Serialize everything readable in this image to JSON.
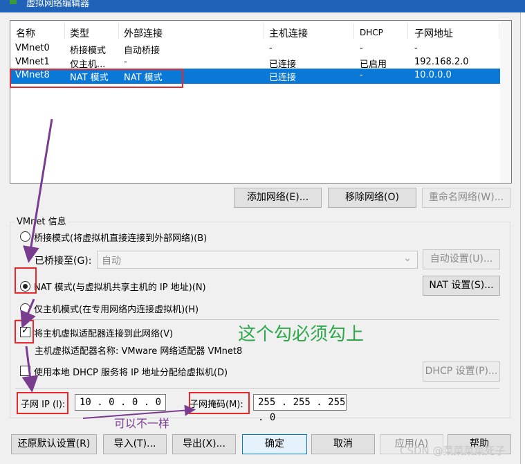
{
  "window": {
    "title": "虚拟网络编辑器"
  },
  "table": {
    "headers": [
      "名称",
      "类型",
      "外部连接",
      "主机连接",
      "DHCP",
      "子网地址"
    ],
    "rows": [
      {
        "name": "VMnet0",
        "type": "桥接模式",
        "external": "自动桥接",
        "host": "-",
        "dhcp": "-",
        "subnet": "-"
      },
      {
        "name": "VMnet1",
        "type": "仅主机...",
        "external": "-",
        "host": "已连接",
        "dhcp": "已启用",
        "subnet": "192.168.2.0"
      },
      {
        "name": "VMnet8",
        "type": "NAT 模式",
        "external": "NAT 模式",
        "host": "已连接",
        "dhcp": "-",
        "subnet": "10.0.0.0",
        "selected": true
      }
    ]
  },
  "net_buttons": {
    "add": "添加网络(E)...",
    "remove": "移除网络(O)",
    "rename": "重命名网络(W)..."
  },
  "info": {
    "group_label": "VMnet 信息",
    "bridged_label": "桥接模式(将虚拟机直接连接到外部网络)(B)",
    "bridged_to_label": "已桥接至(G):",
    "bridged_to_value": "自动",
    "auto_settings": "自动设置(U)...",
    "nat_label": "NAT 模式(与虚拟机共享主机的 IP 地址)(N)",
    "nat_settings": "NAT 设置(S)...",
    "hostonly_label": "仅主机模式(在专用网络内连接虚拟机)(H)",
    "connect_adapter_label": "将主机虚拟适配器连接到此网络(V)",
    "adapter_name_label": "主机虚拟适配器名称: VMware 网络适配器 VMnet8",
    "dhcp_label": "使用本地 DHCP 服务将 IP 地址分配给虚拟机(D)",
    "dhcp_settings": "DHCP 设置(P)...",
    "subnet_ip_label": "子网 IP (I):",
    "subnet_ip_value": "10 . 0 . 0 . 0",
    "subnet_mask_label": "子网掩码(M):",
    "subnet_mask_value": "255 . 255 . 255 . 0"
  },
  "footer": {
    "restore": "还原默认设置(R)",
    "import": "导入(T)...",
    "export": "导出(X)...",
    "ok": "确定",
    "cancel": "取消",
    "apply": "应用(A)",
    "help": "帮助"
  },
  "annotations": {
    "checkbox_note": "这个勾必须勾上",
    "subnet_note": "可以不一样",
    "green_color": "#2ea84b",
    "red_color": "#e8282a",
    "purple_color": "#7a3c8e"
  },
  "watermark": "CSDN @菜菜菜菜死子"
}
